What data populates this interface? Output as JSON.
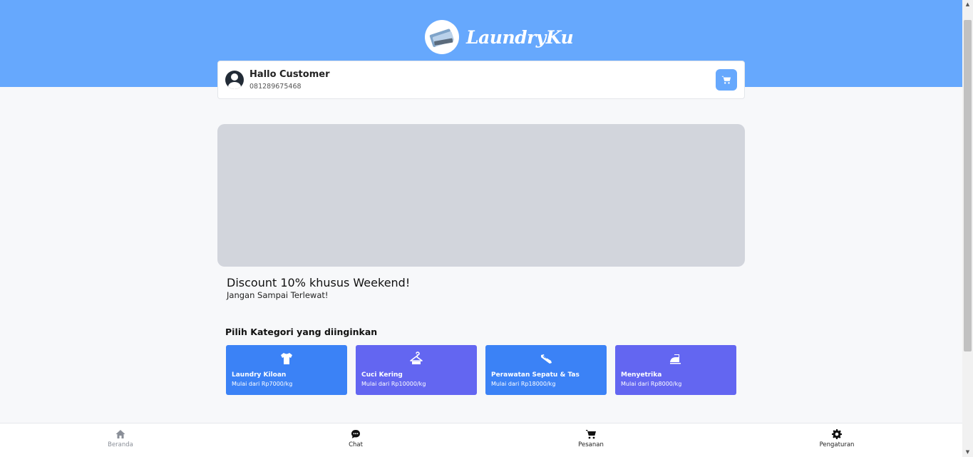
{
  "app": {
    "brand_name": "LaundryKu"
  },
  "user": {
    "greeting": "Hallo Customer",
    "phone": "081289675468"
  },
  "promo": {
    "title": "Discount 10% khusus Weekend!",
    "subtitle": "Jangan Sampai Terlewat!"
  },
  "categories": {
    "heading": "Pilih Kategori yang diinginkan",
    "items": [
      {
        "name": "Laundry Kiloan",
        "price": "Mulai dari Rp7000/kg",
        "icon": "tshirt-icon",
        "color": "#3b82f6"
      },
      {
        "name": "Cuci Kering",
        "price": "Mulai dari Rp10000/kg",
        "icon": "hanger-icon",
        "color": "#6366f1"
      },
      {
        "name": "Perawatan Sepatu & Tas",
        "price": "Mulai dari Rp18000/kg",
        "icon": "shoe-icon",
        "color": "#3b82f6"
      },
      {
        "name": "Menyetrika",
        "price": "Mulai dari Rp8000/kg",
        "icon": "iron-icon",
        "color": "#6366f1"
      }
    ]
  },
  "nav": {
    "items": [
      {
        "label": "Beranda",
        "icon": "home-icon"
      },
      {
        "label": "Chat",
        "icon": "chat-icon"
      },
      {
        "label": "Pesanan",
        "icon": "cart-icon"
      },
      {
        "label": "Pengaturan",
        "icon": "gear-icon"
      }
    ]
  },
  "colors": {
    "header": "#66a8fd",
    "banner_placeholder": "#d2d5dc",
    "card_blue": "#3b82f6",
    "card_indigo": "#6366f1"
  }
}
